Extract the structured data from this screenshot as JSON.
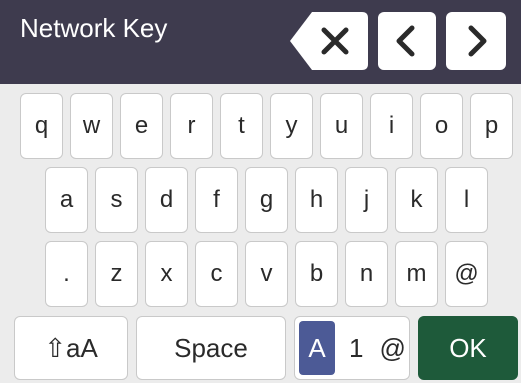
{
  "header": {
    "title": "Network Key",
    "backspace_icon": "backspace-icon",
    "left_icon": "chevron-left-icon",
    "right_icon": "chevron-right-icon"
  },
  "keyboard": {
    "row1": [
      "q",
      "w",
      "e",
      "r",
      "t",
      "y",
      "u",
      "i",
      "o",
      "p"
    ],
    "row2": [
      "a",
      "s",
      "d",
      "f",
      "g",
      "h",
      "j",
      "k",
      "l"
    ],
    "row3": [
      ".",
      "z",
      "x",
      "c",
      "v",
      "b",
      "n",
      "m",
      "@"
    ],
    "shift_label": "⇧aA",
    "space_label": "Space",
    "mode": {
      "selected": "A",
      "num": "1",
      "sym": "@"
    },
    "ok_label": "OK"
  },
  "colors": {
    "header_bg": "#3e3b4e",
    "keyboard_bg": "#ececec",
    "mode_highlight": "#4c5a96",
    "ok_bg": "#1e5a3a"
  }
}
